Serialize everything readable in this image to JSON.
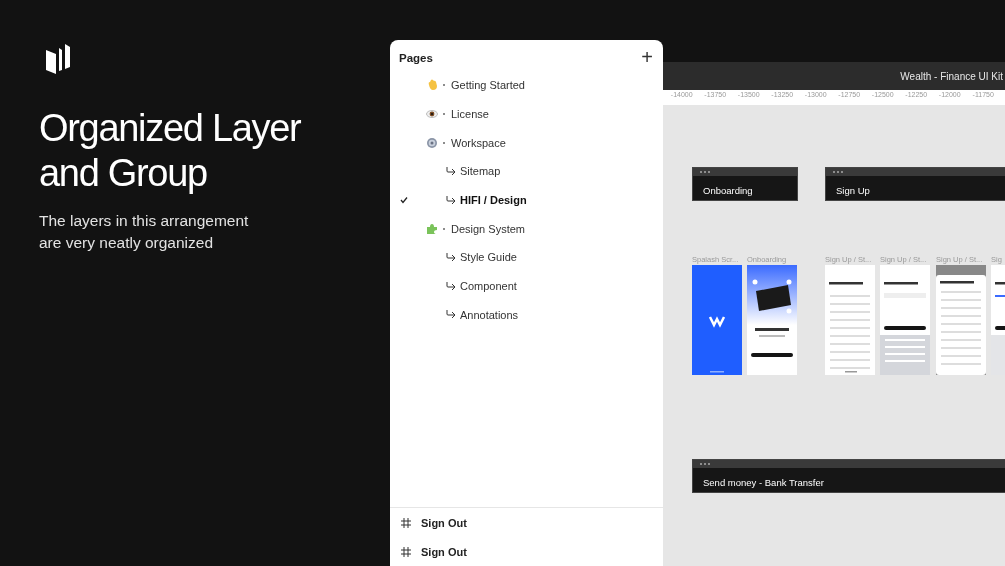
{
  "hero": {
    "title": "Organized Layer and Group",
    "subtitle": "The layers in this arrangement are very neatly organized"
  },
  "pages_panel": {
    "title": "Pages",
    "add_button": "+",
    "pages": [
      {
        "label": "Getting Started",
        "selected": false
      },
      {
        "label": "License",
        "selected": false
      },
      {
        "label": "Workspace",
        "selected": false,
        "children": [
          {
            "label": "Sitemap",
            "selected": false
          },
          {
            "label": "HIFI / Design",
            "selected": true
          }
        ]
      },
      {
        "label": "Design System",
        "selected": false,
        "children": [
          {
            "label": "Style Guide",
            "selected": false
          },
          {
            "label": "Component",
            "selected": false
          },
          {
            "label": "Annotations",
            "selected": false
          }
        ]
      }
    ],
    "layers": [
      {
        "label": "Sign Out"
      },
      {
        "label": "Sign Out"
      }
    ]
  },
  "canvas": {
    "file_title": "Wealth - Finance UI Kit",
    "ruler": [
      "-14000",
      "-13750",
      "-13500",
      "-13250",
      "-13000",
      "-12750",
      "-12500",
      "-12250",
      "-12000",
      "-11750"
    ],
    "sections": [
      {
        "label": "Onboarding"
      },
      {
        "label": "Sign Up"
      },
      {
        "label": "Send money - Bank Transfer"
      }
    ],
    "frames": [
      {
        "label": "Spalash Scr...",
        "kind": "splash"
      },
      {
        "label": "Onboarding",
        "kind": "onboarding"
      },
      {
        "label": "Sign Up / St...",
        "kind": "list"
      },
      {
        "label": "Sign Up / St...",
        "kind": "keyboard"
      },
      {
        "label": "Sign Up / St...",
        "kind": "sheet"
      },
      {
        "label": "Sig",
        "kind": "form"
      }
    ]
  }
}
